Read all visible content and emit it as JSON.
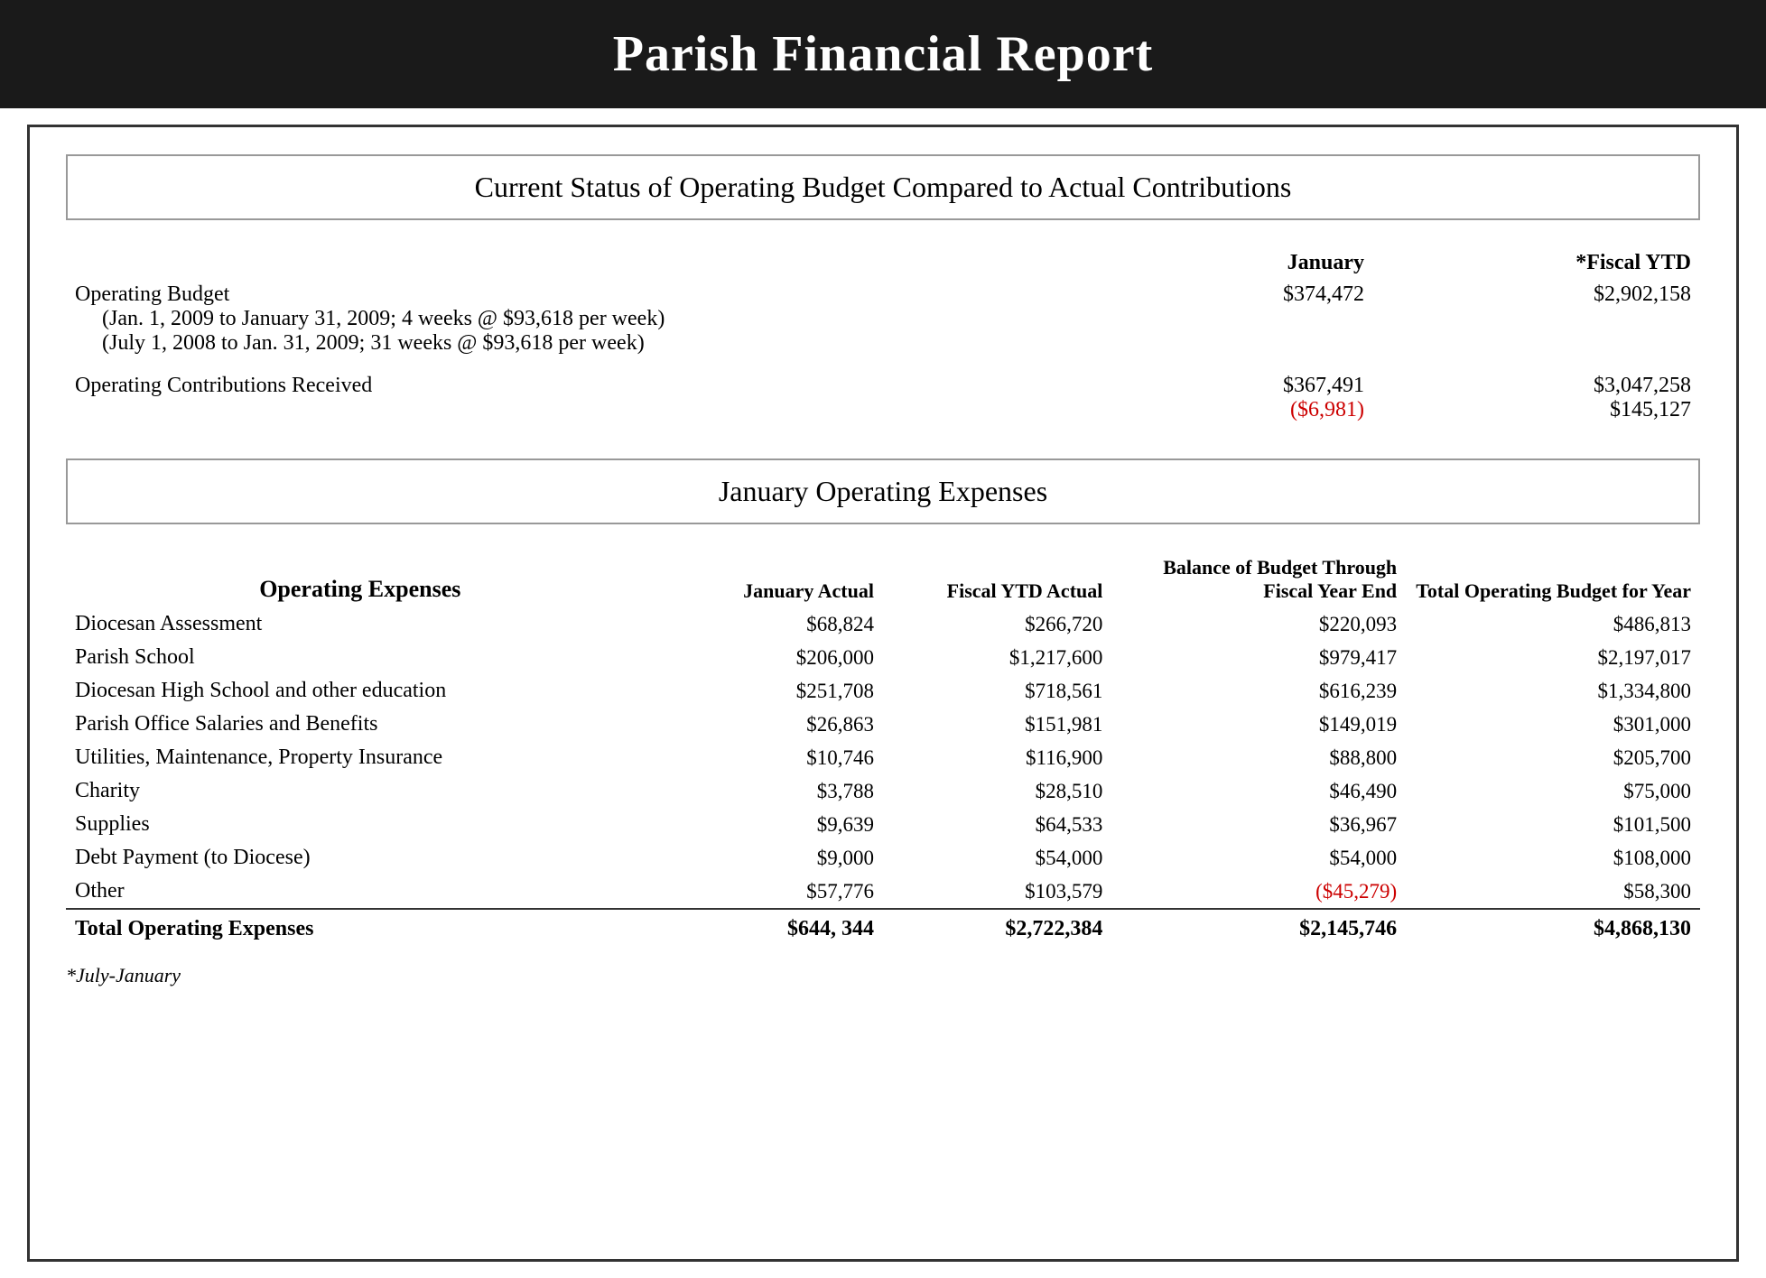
{
  "header": {
    "title": "Parish Financial Report"
  },
  "operating_budget_section": {
    "title": "Current Status of Operating Budget Compared to Actual Contributions",
    "col_jan": "January",
    "col_ytd": "*Fiscal YTD",
    "rows": [
      {
        "label": "Operating Budget",
        "sublabel1": "(Jan. 1, 2009 to January 31, 2009; 4 weeks @ $93,618 per week)",
        "sublabel2": "(July 1, 2008 to Jan. 31, 2009; 31 weeks @ $93,618 per week)",
        "jan": "$374,472",
        "ytd": "$2,902,158"
      },
      {
        "label": "Operating Contributions Received",
        "jan": "$367,491",
        "jan_diff": "($6,981)",
        "ytd": "$3,047,258",
        "ytd_diff": "$145,127"
      }
    ]
  },
  "expenses_section": {
    "title": "January Operating Expenses",
    "col_name": "Operating Expenses",
    "col_jan_act": "January Actual",
    "col_fytd_act": "Fiscal YTD Actual",
    "col_balance": "Balance of Budget Through Fiscal Year End",
    "col_total": "Total Operating Budget for Year",
    "rows": [
      {
        "name": "Diocesan Assessment",
        "jan_act": "$68,824",
        "fytd_act": "$266,720",
        "balance": "$220,093",
        "total": "$486,813",
        "negative_balance": false
      },
      {
        "name": "Parish School",
        "jan_act": "$206,000",
        "fytd_act": "$1,217,600",
        "balance": "$979,417",
        "total": "$2,197,017",
        "negative_balance": false
      },
      {
        "name": "Diocesan High School and other education",
        "jan_act": "$251,708",
        "fytd_act": "$718,561",
        "balance": "$616,239",
        "total": "$1,334,800",
        "negative_balance": false
      },
      {
        "name": "Parish Office Salaries and Benefits",
        "jan_act": "$26,863",
        "fytd_act": "$151,981",
        "balance": "$149,019",
        "total": "$301,000",
        "negative_balance": false
      },
      {
        "name": "Utilities, Maintenance, Property Insurance",
        "jan_act": "$10,746",
        "fytd_act": "$116,900",
        "balance": "$88,800",
        "total": "$205,700",
        "negative_balance": false
      },
      {
        "name": "Charity",
        "jan_act": "$3,788",
        "fytd_act": "$28,510",
        "balance": "$46,490",
        "total": "$75,000",
        "negative_balance": false
      },
      {
        "name": "Supplies",
        "jan_act": "$9,639",
        "fytd_act": "$64,533",
        "balance": "$36,967",
        "total": "$101,500",
        "negative_balance": false
      },
      {
        "name": "Debt Payment (to Diocese)",
        "jan_act": "$9,000",
        "fytd_act": "$54,000",
        "balance": "$54,000",
        "total": "$108,000",
        "negative_balance": false
      },
      {
        "name": "Other",
        "jan_act": "$57,776",
        "fytd_act": "$103,579",
        "balance": "($45,279)",
        "total": "$58,300",
        "negative_balance": true
      }
    ],
    "total_row": {
      "name": "Total Operating Expenses",
      "jan_act": "$644, 344",
      "fytd_act": "$2,722,384",
      "balance": "$2,145,746",
      "total": "$4,868,130"
    }
  },
  "footnote": "*July-January"
}
